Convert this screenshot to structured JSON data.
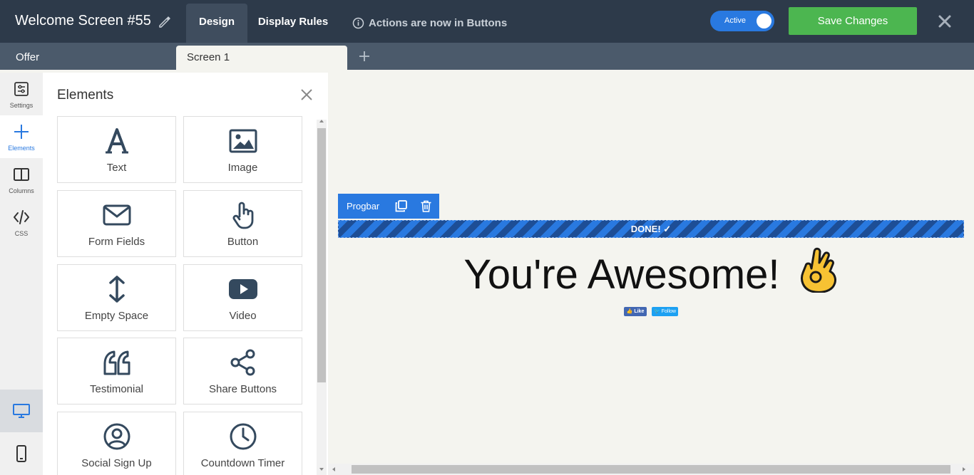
{
  "header": {
    "title": "Welcome Screen #55",
    "tabs": [
      {
        "label": "Design",
        "active": true
      },
      {
        "label": "Display Rules",
        "active": false
      }
    ],
    "notice": "Actions are now in Buttons",
    "status_toggle": {
      "label": "Active",
      "on": true
    },
    "save_label": "Save Changes"
  },
  "subbar": {
    "offer_label": "Offer",
    "screen_tab": "Screen 1"
  },
  "rail": {
    "items": [
      {
        "label": "Settings",
        "icon": "settings-icon"
      },
      {
        "label": "Elements",
        "icon": "plus-icon",
        "active": true
      },
      {
        "label": "Columns",
        "icon": "columns-icon"
      },
      {
        "label": "CSS",
        "icon": "code-icon"
      }
    ],
    "devices": [
      {
        "icon": "desktop-icon",
        "active": true
      },
      {
        "icon": "mobile-icon",
        "active": false
      }
    ]
  },
  "panel": {
    "title": "Elements",
    "tiles": [
      {
        "label": "Text",
        "icon": "text-icon"
      },
      {
        "label": "Image",
        "icon": "image-icon"
      },
      {
        "label": "Form Fields",
        "icon": "envelope-icon"
      },
      {
        "label": "Button",
        "icon": "pointer-hand-icon"
      },
      {
        "label": "Empty Space",
        "icon": "vertical-arrows-icon"
      },
      {
        "label": "Video",
        "icon": "video-icon"
      },
      {
        "label": "Testimonial",
        "icon": "quote-icon"
      },
      {
        "label": "Share Buttons",
        "icon": "share-icon"
      },
      {
        "label": "Social Sign Up",
        "icon": "user-circle-icon"
      },
      {
        "label": "Countdown Timer",
        "icon": "clock-icon"
      }
    ]
  },
  "canvas": {
    "toolbar_label": "Progbar",
    "progress_text": "DONE! ✓",
    "progress_value": 1.0,
    "headline": "You're Awesome!",
    "fb_like": "Like",
    "tw_follow": "Follow"
  },
  "colors": {
    "topbar": "#2d3a4a",
    "accent_blue": "#2979e0",
    "save_green": "#4cb650"
  }
}
